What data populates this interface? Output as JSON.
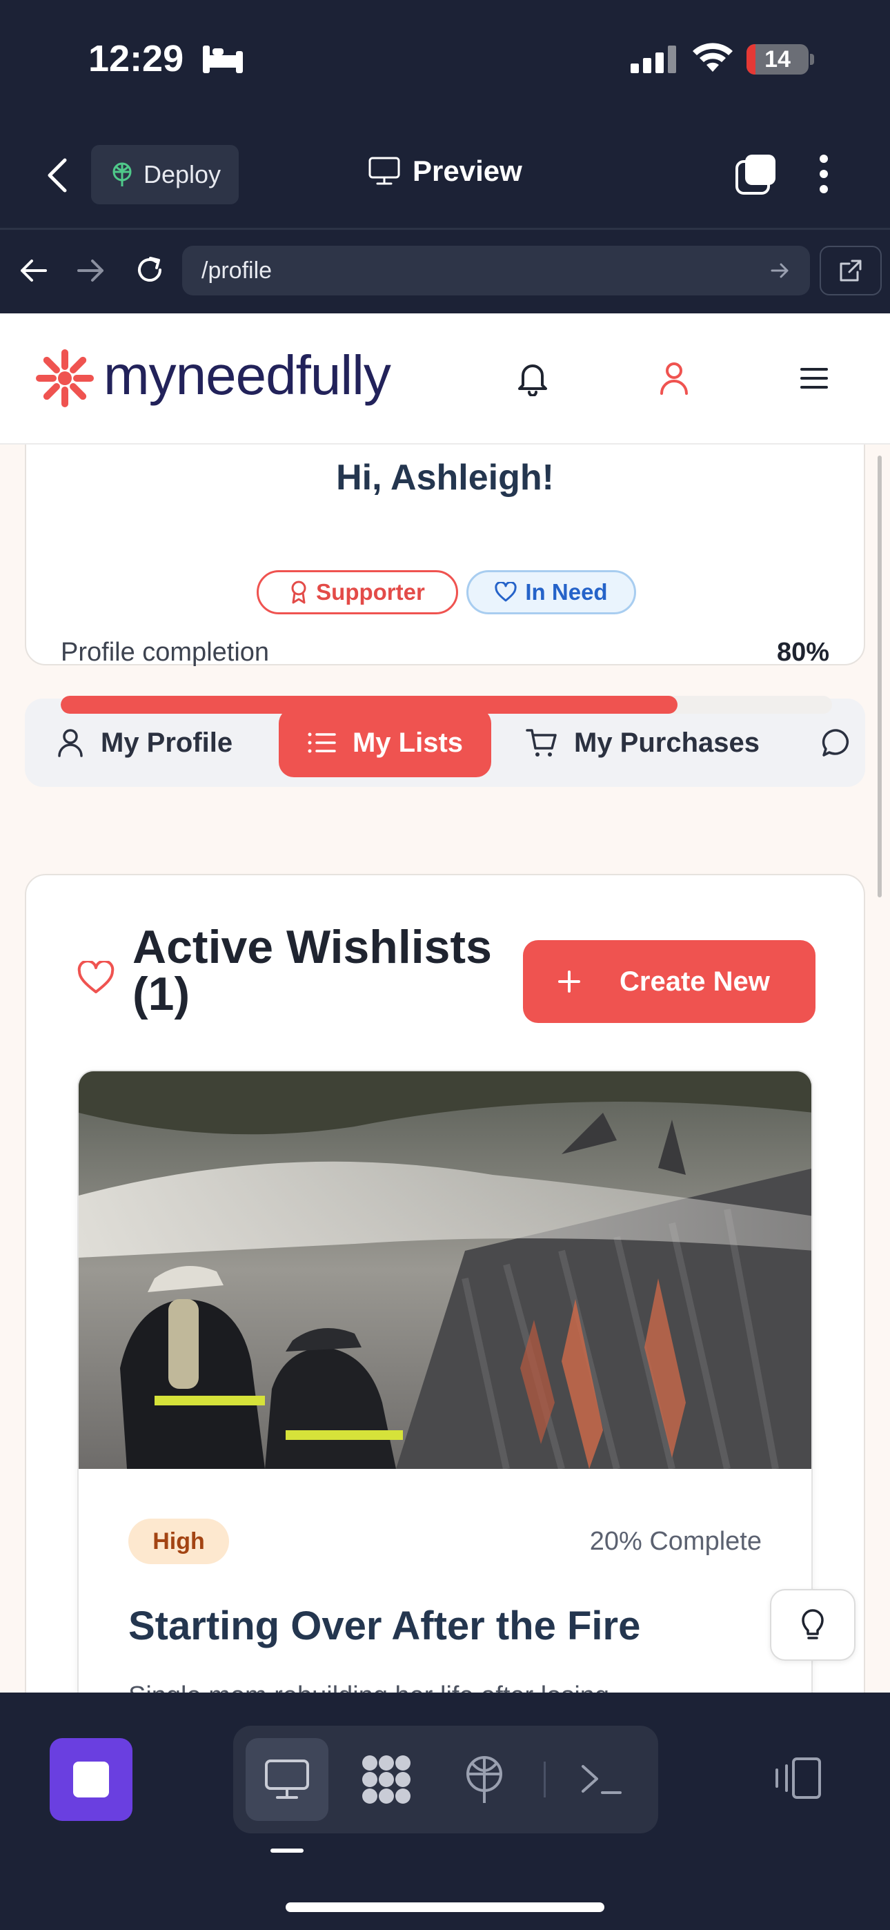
{
  "status_bar": {
    "time": "12:29",
    "battery": "14",
    "battery_level": 0.14
  },
  "toolbar": {
    "deploy_label": "Deploy",
    "preview_label": "Preview"
  },
  "url_bar": {
    "url": "/profile"
  },
  "site": {
    "logo_text": "myneedfully",
    "greeting": "Hi, Ashleigh!",
    "badges": {
      "supporter": "Supporter",
      "in_need": "In Need"
    },
    "profile_completion": {
      "label": "Profile completion",
      "value_text": "80%",
      "value": 0.8
    },
    "tabs": [
      {
        "label": "My Profile",
        "icon": "user-icon"
      },
      {
        "label": "My Lists",
        "icon": "list-icon",
        "active": true
      },
      {
        "label": "My Purchases",
        "icon": "cart-icon"
      },
      {
        "label": "",
        "icon": "message-icon"
      }
    ],
    "wishlists": {
      "heading": "Active Wishlists (1)",
      "create_label": "Create New",
      "items": [
        {
          "priority": "High",
          "progress_text": "20% Complete",
          "progress": 0.2,
          "title": "Starting Over After the Fire",
          "description": "Single mom rebuilding her life after losing"
        }
      ]
    }
  },
  "colors": {
    "brand": "#ef5350",
    "navy": "#24364f",
    "dark_chrome": "#1c2236",
    "stop_button": "#6a3fe0"
  }
}
